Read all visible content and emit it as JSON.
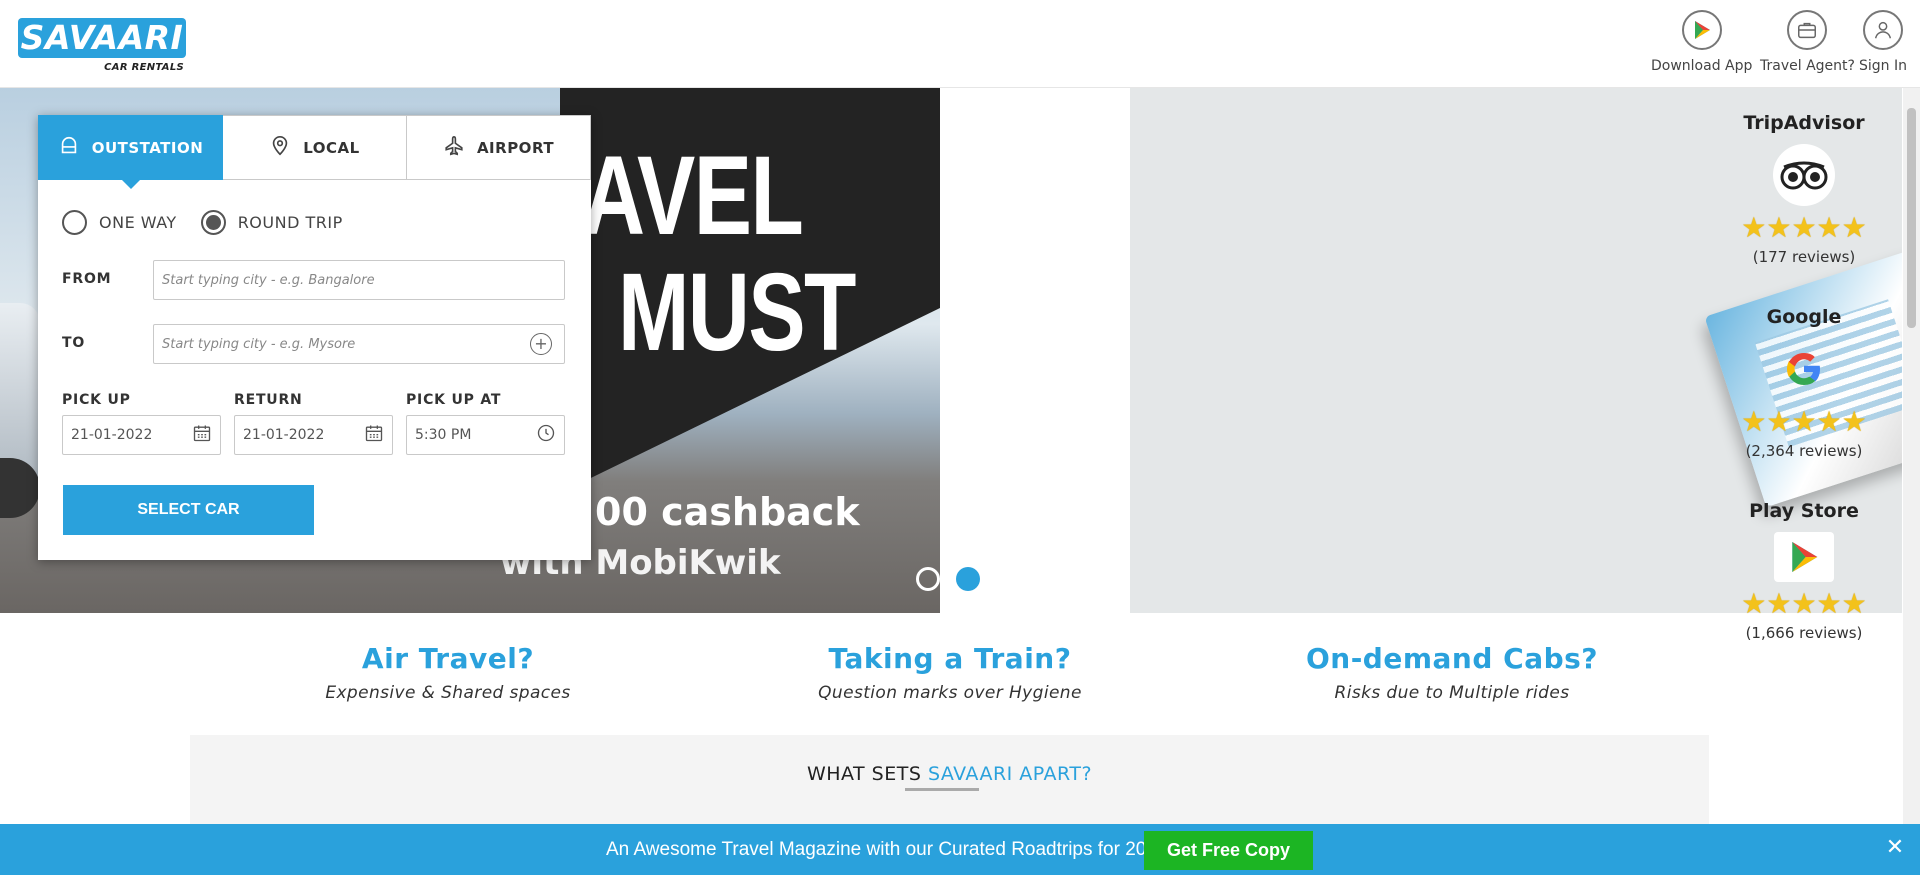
{
  "brand": {
    "name": "SAVAARI",
    "tagline": "CAR RENTALS",
    "accent": "#2aa1dc"
  },
  "header": {
    "actions": [
      {
        "label": "Download App",
        "icon": "play-store-icon"
      },
      {
        "label": "Travel Agent?",
        "icon": "briefcase-icon"
      },
      {
        "label": "Sign In",
        "icon": "user-icon"
      }
    ]
  },
  "hero": {
    "line1": "00 cashback",
    "line2": "with MobiKwik",
    "headline1": "AVEL",
    "headline2": "MUST"
  },
  "booking": {
    "tabs": [
      {
        "label": "OUTSTATION",
        "icon": "car-front-icon",
        "active": true
      },
      {
        "label": "LOCAL",
        "icon": "location-pin-icon",
        "active": false
      },
      {
        "label": "AIRPORT",
        "icon": "airplane-icon",
        "active": false
      }
    ],
    "trip_types": [
      {
        "label": "ONE WAY",
        "selected": false
      },
      {
        "label": "ROUND TRIP",
        "selected": true
      }
    ],
    "from": {
      "label": "FROM",
      "placeholder": "Start typing city - e.g. Bangalore"
    },
    "to": {
      "label": "TO",
      "placeholder": "Start typing city - e.g. Mysore"
    },
    "pickup": {
      "label": "PICK UP",
      "value": "21-01-2022"
    },
    "return": {
      "label": "RETURN",
      "value": "21-01-2022"
    },
    "pickup_at": {
      "label": "PICK UP AT",
      "value": "5:30 PM"
    },
    "submit_label": "SELECT CAR"
  },
  "ratings": [
    {
      "title": "TripAdvisor",
      "stars": "★★★★★",
      "reviews": "(177 reviews)"
    },
    {
      "title": "Google",
      "stars": "★★★★★",
      "reviews": "(2,364 reviews)"
    },
    {
      "title": "Play Store",
      "stars": "★★★★★",
      "reviews": "(1,666 reviews)"
    }
  ],
  "pain_points": [
    {
      "title": "Air Travel?",
      "subtitle": "Expensive & Shared spaces"
    },
    {
      "title": "Taking a Train?",
      "subtitle": "Question marks over Hygiene"
    },
    {
      "title": "On-demand Cabs?",
      "subtitle": "Risks due to Multiple rides"
    }
  ],
  "apart": {
    "prefix": "WHAT SETS ",
    "highlight": "SAVAARI APART?"
  },
  "promo": {
    "text": "An Awesome Travel Magazine with our Curated Roadtrips for 2022",
    "button": "Get Free Copy",
    "close": "✕"
  }
}
